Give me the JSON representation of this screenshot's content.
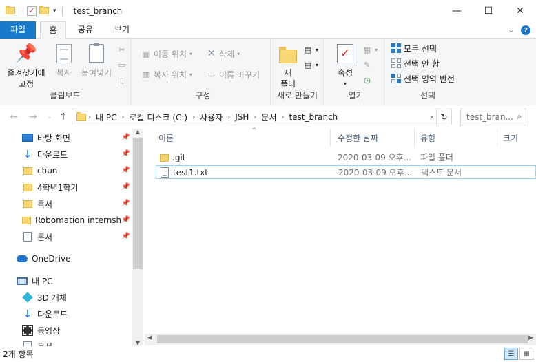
{
  "window": {
    "title": "test_branch",
    "minimize": "—",
    "maximize": "☐",
    "close": "✕"
  },
  "ribbon_tabs": [
    "파일",
    "홈",
    "공유",
    "보기"
  ],
  "ribbon": {
    "clipboard": {
      "pin_label_1": "즐겨찾기에",
      "pin_label_2": "고정",
      "copy_label": "복사",
      "paste_label": "붙여넣기",
      "group_label": "클립보드"
    },
    "organize": {
      "move_to": "이동 위치",
      "copy_to": "복사 위치",
      "delete": "삭제",
      "rename": "이름 바꾸기",
      "group_label": "구성"
    },
    "new": {
      "new_folder_1": "새",
      "new_folder_2": "폴더",
      "group_label": "새로 만들기"
    },
    "open": {
      "properties": "속성",
      "group_label": "열기"
    },
    "select": {
      "select_all": "모두 선택",
      "select_none": "선택 안 함",
      "invert": "선택 영역 반전",
      "group_label": "선택"
    }
  },
  "address": {
    "crumbs": [
      "내 PC",
      "로컬 디스크 (C:)",
      "사용자",
      "JSH",
      "문서",
      "test_branch"
    ],
    "search_placeholder": "test_bran..."
  },
  "nav_pane": {
    "items": [
      {
        "label": "바탕 화면",
        "icon": "desktop-icon",
        "pinned": true
      },
      {
        "label": "다운로드",
        "icon": "download-icon",
        "pinned": true
      },
      {
        "label": "chun",
        "icon": "folder-icon",
        "pinned": true
      },
      {
        "label": "4학년1학기",
        "icon": "folder-icon",
        "pinned": true
      },
      {
        "label": "독서",
        "icon": "folder-icon",
        "pinned": true
      },
      {
        "label": "Robomation internship",
        "icon": "folder-icon",
        "pinned": true
      },
      {
        "label": "문서",
        "icon": "document-icon",
        "pinned": true
      },
      {
        "label": "OneDrive",
        "icon": "cloud-icon",
        "pinned": false
      },
      {
        "label": "내 PC",
        "icon": "pc-icon",
        "pinned": false
      },
      {
        "label": "3D 개체",
        "icon": "cube-icon",
        "pinned": false
      },
      {
        "label": "다운로드",
        "icon": "download-icon",
        "pinned": false
      },
      {
        "label": "동영상",
        "icon": "video-icon",
        "pinned": false
      },
      {
        "label": "문서",
        "icon": "document-icon",
        "pinned": false
      }
    ]
  },
  "file_list": {
    "columns": [
      "이름",
      "수정한 날짜",
      "유형",
      "크기"
    ],
    "rows": [
      {
        "name": ".git",
        "modified": "2020-03-09 오후...",
        "type": "파일 폴더",
        "icon": "folder-icon"
      },
      {
        "name": "test1.txt",
        "modified": "2020-03-09 오후...",
        "type": "텍스트 문서",
        "icon": "text-file-icon"
      }
    ]
  },
  "status": {
    "item_count": "2개 항목"
  }
}
